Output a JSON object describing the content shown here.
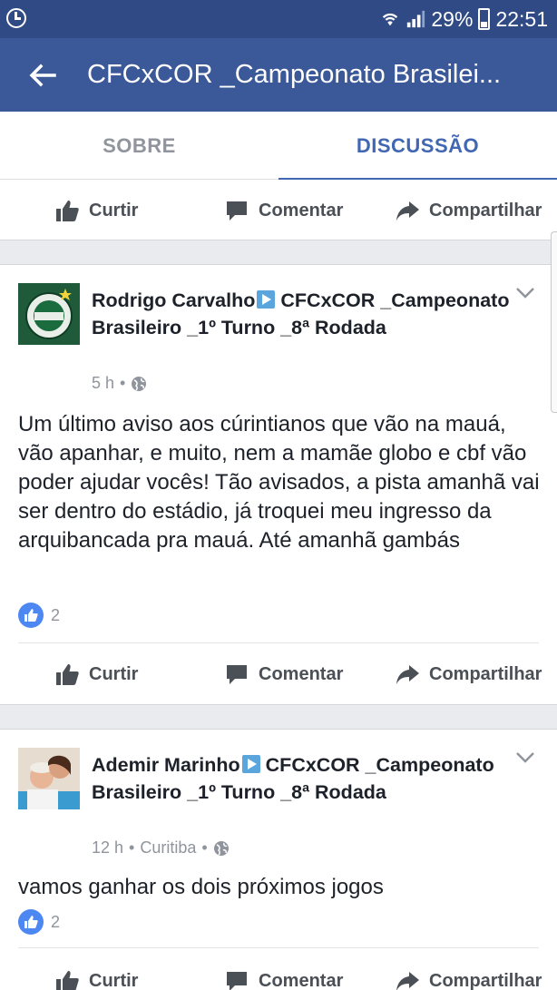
{
  "status_bar": {
    "battery": "29%",
    "time": "22:51"
  },
  "app_bar": {
    "title": "CFCxCOR _Campeonato Brasilei..."
  },
  "tabs": [
    {
      "label": "SOBRE"
    },
    {
      "label": "DISCUSSÃO"
    }
  ],
  "actions": {
    "like": "Curtir",
    "comment": "Comentar",
    "share": "Compartilhar"
  },
  "posts": [
    {
      "author": "Rodrigo Carvalho",
      "target": "CFCxCOR _Campeonato Brasileiro _1º Turno _8ª Rodada",
      "time": "5 h",
      "location": "",
      "text": "Um último aviso aos cúrintianos que vão na mauá, vão apanhar, e muito, nem a mamãe globo e cbf vão poder ajudar vocês! Tão avisados, a pista amanhã vai ser dentro do estádio, já troquei meu ingresso da arquibancada pra mauá. Até amanhã gambás",
      "likes": "2"
    },
    {
      "author": "Ademir Marinho",
      "target": "CFCxCOR _Campeonato Brasileiro _1º Turno _8ª Rodada",
      "time": "12 h",
      "location": "Curitiba",
      "text": "vamos ganhar os dois próximos jogos",
      "likes": "2"
    }
  ],
  "colors": {
    "status_bar": "#2f4a85",
    "app_bar": "#3b5998",
    "accent": "#4267b2",
    "like_badge": "#4c87f2"
  }
}
